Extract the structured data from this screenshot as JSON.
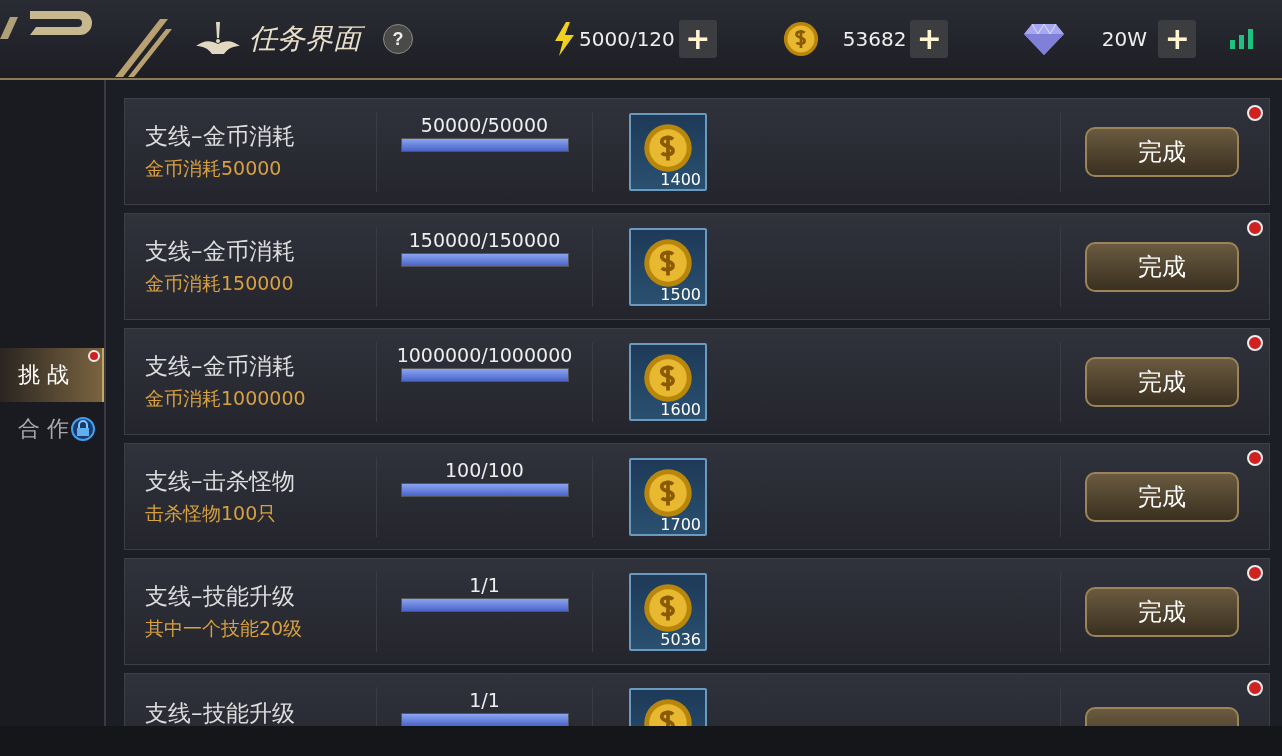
{
  "header": {
    "title": "任务界面",
    "help": "?"
  },
  "resources": [
    {
      "kind": "energy",
      "value": "5000/120",
      "add": "+"
    },
    {
      "kind": "gold",
      "value": "53682",
      "add": "+"
    },
    {
      "kind": "diamond",
      "value": "20W",
      "add": "+"
    }
  ],
  "sidebar": {
    "tabs": [
      {
        "label": "挑 战",
        "selected": true,
        "notify": true,
        "locked": false
      },
      {
        "label": "合 作",
        "selected": false,
        "notify": false,
        "locked": true
      }
    ]
  },
  "tasks": [
    {
      "title": "支线–金币消耗",
      "subtitle": "金币消耗50000",
      "progress": "50000/50000",
      "level": 1,
      "reward": "1400",
      "button": "完成",
      "notify": true
    },
    {
      "title": "支线–金币消耗",
      "subtitle": "金币消耗150000",
      "progress": "150000/150000",
      "level": 1,
      "reward": "1500",
      "button": "完成",
      "notify": true
    },
    {
      "title": "支线–金币消耗",
      "subtitle": "金币消耗1000000",
      "progress": "1000000/1000000",
      "level": 1,
      "reward": "1600",
      "button": "完成",
      "notify": true
    },
    {
      "title": "支线–击杀怪物",
      "subtitle": "击杀怪物100只",
      "progress": "100/100",
      "level": 1,
      "reward": "1700",
      "button": "完成",
      "notify": true
    },
    {
      "title": "支线–技能升级",
      "subtitle": "其中一个技能20级",
      "progress": "1/1",
      "level": 1,
      "reward": "5036",
      "button": "完成",
      "notify": true
    },
    {
      "title": "支线–技能升级",
      "progress": "1/1",
      "level": 1,
      "notify": true
    }
  ]
}
